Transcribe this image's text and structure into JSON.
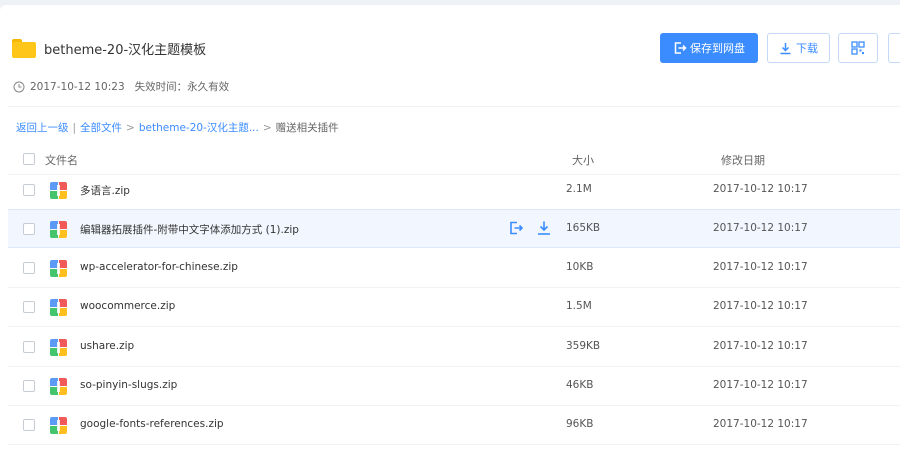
{
  "share": {
    "title": "betheme-20-汉化主题模板",
    "date": "2017-10-12 10:23",
    "expire": "失效时间：永久有效"
  },
  "actions": {
    "save_label": "保存到网盘",
    "download_label": "下载"
  },
  "breadcrumb": {
    "back": "返回上一级",
    "sep": "|",
    "all_files": "全部文件",
    "arrow": ">",
    "folder": "betheme-20-汉化主题...",
    "current": "赠送相关插件"
  },
  "table": {
    "headers": {
      "name": "文件名",
      "size": "大小",
      "date": "修改日期"
    },
    "rows": [
      {
        "name": "多语言.zip",
        "size": "2.1M",
        "date": "2017-10-12 10:17"
      },
      {
        "name": "编辑器拓展插件-附带中文字体添加方式 (1).zip",
        "size": "165KB",
        "date": "2017-10-12 10:17"
      },
      {
        "name": "wp-accelerator-for-chinese.zip",
        "size": "10KB",
        "date": "2017-10-12 10:17"
      },
      {
        "name": "woocommerce.zip",
        "size": "1.5M",
        "date": "2017-10-12 10:17"
      },
      {
        "name": "ushare.zip",
        "size": "359KB",
        "date": "2017-10-12 10:17"
      },
      {
        "name": "so-pinyin-slugs.zip",
        "size": "46KB",
        "date": "2017-10-12 10:17"
      },
      {
        "name": "google-fonts-references.zip",
        "size": "96KB",
        "date": "2017-10-12 10:17"
      }
    ]
  },
  "colors": {
    "accent": "#3b8cff",
    "folder": "#ffc61a",
    "row_highlight": "#f2f7ff"
  },
  "icons": [
    "folder-icon",
    "clock-icon",
    "save-icon",
    "download-icon",
    "qrcode-icon",
    "zip-file-icon"
  ]
}
